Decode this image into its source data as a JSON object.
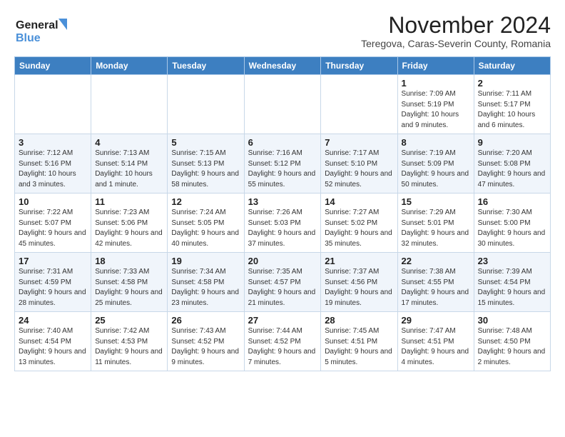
{
  "header": {
    "logo_line1": "General",
    "logo_line2": "Blue",
    "title": "November 2024",
    "subtitle": "Teregova, Caras-Severin County, Romania"
  },
  "weekdays": [
    "Sunday",
    "Monday",
    "Tuesday",
    "Wednesday",
    "Thursday",
    "Friday",
    "Saturday"
  ],
  "weeks": [
    [
      {
        "day": "",
        "info": ""
      },
      {
        "day": "",
        "info": ""
      },
      {
        "day": "",
        "info": ""
      },
      {
        "day": "",
        "info": ""
      },
      {
        "day": "",
        "info": ""
      },
      {
        "day": "1",
        "info": "Sunrise: 7:09 AM\nSunset: 5:19 PM\nDaylight: 10 hours and 9 minutes."
      },
      {
        "day": "2",
        "info": "Sunrise: 7:11 AM\nSunset: 5:17 PM\nDaylight: 10 hours and 6 minutes."
      }
    ],
    [
      {
        "day": "3",
        "info": "Sunrise: 7:12 AM\nSunset: 5:16 PM\nDaylight: 10 hours and 3 minutes."
      },
      {
        "day": "4",
        "info": "Sunrise: 7:13 AM\nSunset: 5:14 PM\nDaylight: 10 hours and 1 minute."
      },
      {
        "day": "5",
        "info": "Sunrise: 7:15 AM\nSunset: 5:13 PM\nDaylight: 9 hours and 58 minutes."
      },
      {
        "day": "6",
        "info": "Sunrise: 7:16 AM\nSunset: 5:12 PM\nDaylight: 9 hours and 55 minutes."
      },
      {
        "day": "7",
        "info": "Sunrise: 7:17 AM\nSunset: 5:10 PM\nDaylight: 9 hours and 52 minutes."
      },
      {
        "day": "8",
        "info": "Sunrise: 7:19 AM\nSunset: 5:09 PM\nDaylight: 9 hours and 50 minutes."
      },
      {
        "day": "9",
        "info": "Sunrise: 7:20 AM\nSunset: 5:08 PM\nDaylight: 9 hours and 47 minutes."
      }
    ],
    [
      {
        "day": "10",
        "info": "Sunrise: 7:22 AM\nSunset: 5:07 PM\nDaylight: 9 hours and 45 minutes."
      },
      {
        "day": "11",
        "info": "Sunrise: 7:23 AM\nSunset: 5:06 PM\nDaylight: 9 hours and 42 minutes."
      },
      {
        "day": "12",
        "info": "Sunrise: 7:24 AM\nSunset: 5:05 PM\nDaylight: 9 hours and 40 minutes."
      },
      {
        "day": "13",
        "info": "Sunrise: 7:26 AM\nSunset: 5:03 PM\nDaylight: 9 hours and 37 minutes."
      },
      {
        "day": "14",
        "info": "Sunrise: 7:27 AM\nSunset: 5:02 PM\nDaylight: 9 hours and 35 minutes."
      },
      {
        "day": "15",
        "info": "Sunrise: 7:29 AM\nSunset: 5:01 PM\nDaylight: 9 hours and 32 minutes."
      },
      {
        "day": "16",
        "info": "Sunrise: 7:30 AM\nSunset: 5:00 PM\nDaylight: 9 hours and 30 minutes."
      }
    ],
    [
      {
        "day": "17",
        "info": "Sunrise: 7:31 AM\nSunset: 4:59 PM\nDaylight: 9 hours and 28 minutes."
      },
      {
        "day": "18",
        "info": "Sunrise: 7:33 AM\nSunset: 4:58 PM\nDaylight: 9 hours and 25 minutes."
      },
      {
        "day": "19",
        "info": "Sunrise: 7:34 AM\nSunset: 4:58 PM\nDaylight: 9 hours and 23 minutes."
      },
      {
        "day": "20",
        "info": "Sunrise: 7:35 AM\nSunset: 4:57 PM\nDaylight: 9 hours and 21 minutes."
      },
      {
        "day": "21",
        "info": "Sunrise: 7:37 AM\nSunset: 4:56 PM\nDaylight: 9 hours and 19 minutes."
      },
      {
        "day": "22",
        "info": "Sunrise: 7:38 AM\nSunset: 4:55 PM\nDaylight: 9 hours and 17 minutes."
      },
      {
        "day": "23",
        "info": "Sunrise: 7:39 AM\nSunset: 4:54 PM\nDaylight: 9 hours and 15 minutes."
      }
    ],
    [
      {
        "day": "24",
        "info": "Sunrise: 7:40 AM\nSunset: 4:54 PM\nDaylight: 9 hours and 13 minutes."
      },
      {
        "day": "25",
        "info": "Sunrise: 7:42 AM\nSunset: 4:53 PM\nDaylight: 9 hours and 11 minutes."
      },
      {
        "day": "26",
        "info": "Sunrise: 7:43 AM\nSunset: 4:52 PM\nDaylight: 9 hours and 9 minutes."
      },
      {
        "day": "27",
        "info": "Sunrise: 7:44 AM\nSunset: 4:52 PM\nDaylight: 9 hours and 7 minutes."
      },
      {
        "day": "28",
        "info": "Sunrise: 7:45 AM\nSunset: 4:51 PM\nDaylight: 9 hours and 5 minutes."
      },
      {
        "day": "29",
        "info": "Sunrise: 7:47 AM\nSunset: 4:51 PM\nDaylight: 9 hours and 4 minutes."
      },
      {
        "day": "30",
        "info": "Sunrise: 7:48 AM\nSunset: 4:50 PM\nDaylight: 9 hours and 2 minutes."
      }
    ]
  ]
}
